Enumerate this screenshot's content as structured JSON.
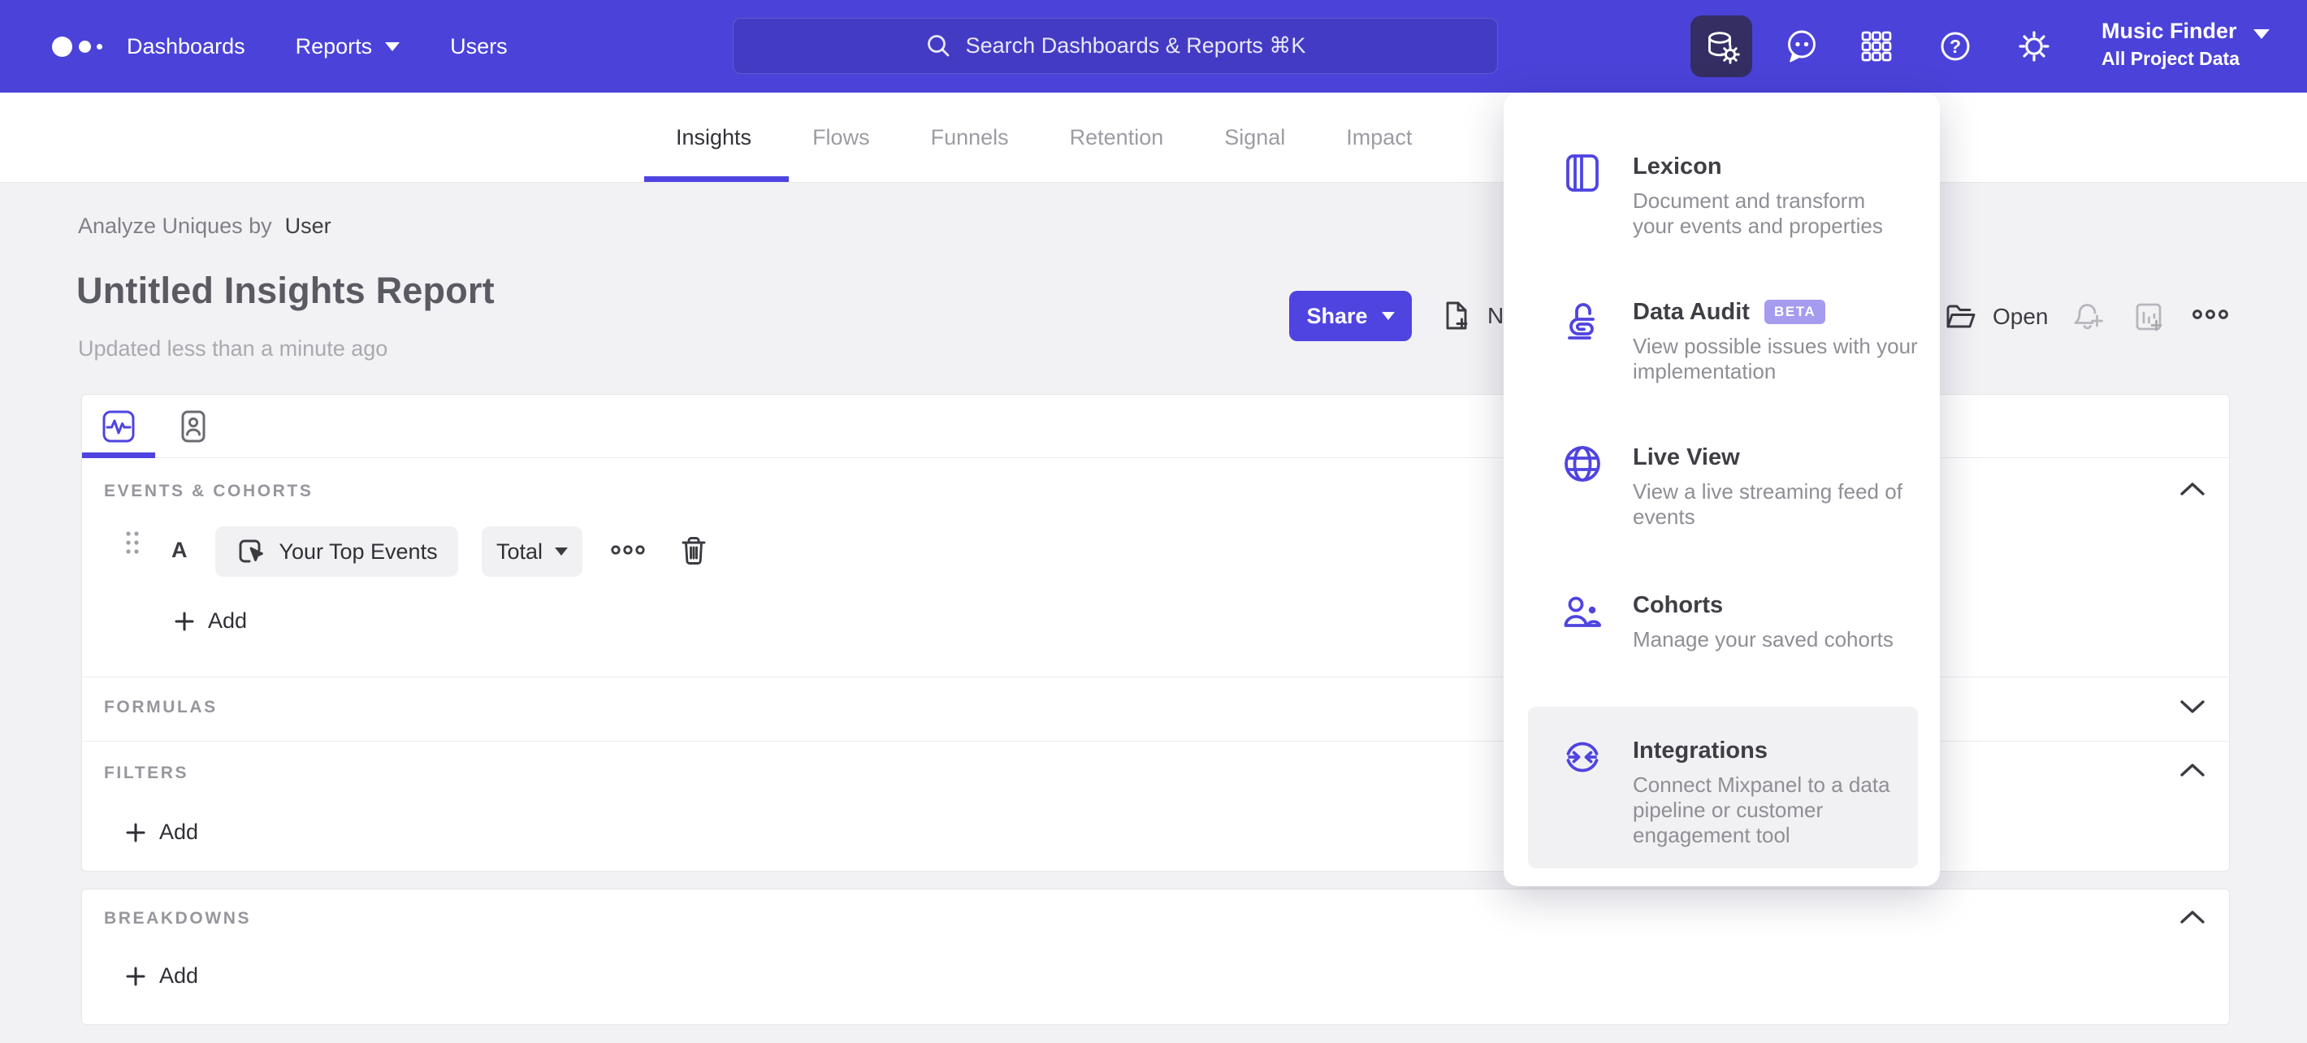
{
  "colors": {
    "accent": "#4f44e0",
    "nav_bg": "#4b42d9",
    "active_tile_bg": "#342e63",
    "beta_badge_bg": "#a59cef",
    "page_bg": "#f2f2f4"
  },
  "topnav": {
    "items": [
      {
        "label": "Dashboards"
      },
      {
        "label": "Reports"
      },
      {
        "label": "Users"
      }
    ],
    "search_placeholder": "Search Dashboards & Reports ⌘K",
    "project": {
      "name": "Music Finder",
      "scope": "All Project Data"
    }
  },
  "report_tabs": {
    "tabs": [
      "Insights",
      "Flows",
      "Funnels",
      "Retention",
      "Signal",
      "Impact"
    ],
    "active": "Insights"
  },
  "report": {
    "breadcrumb_prefix": "Analyze Uniques by",
    "breadcrumb_value": "User",
    "title": "Untitled Insights Report",
    "updated": "Updated less than a minute ago"
  },
  "toolbar": {
    "share_label": "Share",
    "new_label": "New",
    "open_label": "Open"
  },
  "builder": {
    "events": {
      "label": "EVENTS & COHORTS",
      "row_letter": "A",
      "event_name": "Your Top Events",
      "aggregation": "Total",
      "add_label": "Add"
    },
    "formulas": {
      "label": "FORMULAS"
    },
    "filters": {
      "label": "FILTERS",
      "add_label": "Add"
    },
    "breakdowns": {
      "label": "BREAKDOWNS",
      "add_label": "Add"
    }
  },
  "menu": {
    "items": [
      {
        "title": "Lexicon",
        "desc": "Document and transform\nyour events and properties"
      },
      {
        "title": "Data Audit",
        "badge": "BETA",
        "desc": "View possible issues with your\nimplementation"
      },
      {
        "title": "Live View",
        "desc": "View a live streaming feed of\nevents"
      },
      {
        "title": "Cohorts",
        "desc": "Manage your saved cohorts"
      },
      {
        "title": "Integrations",
        "desc": "Connect Mixpanel to a data\npipeline or customer\nengagement tool",
        "highlighted": true
      }
    ]
  }
}
